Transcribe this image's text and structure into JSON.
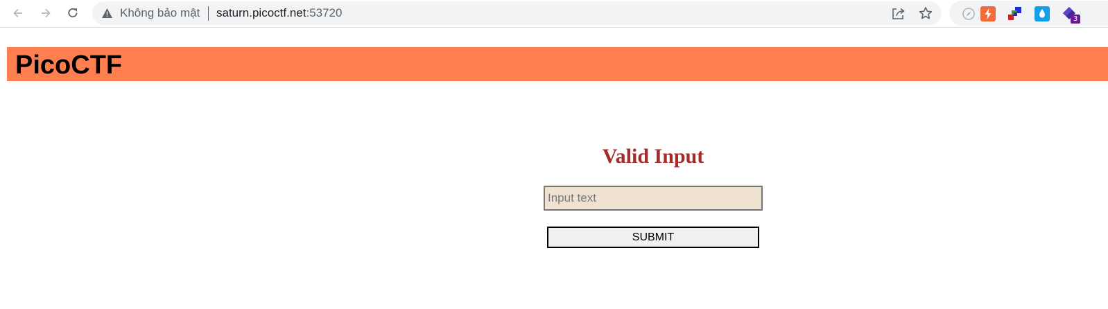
{
  "browser": {
    "security_label": "Không bảo mật",
    "url_host": "saturn.picoctf.net",
    "url_port": ":53720",
    "extension_badge_count": "3",
    "icons": [
      "back-arrow-icon",
      "forward-arrow-icon",
      "reload-icon",
      "warning-icon",
      "share-icon",
      "star-icon",
      "compass-icon",
      "bolt-icon",
      "squares-icon",
      "drop-icon",
      "diamond-icon"
    ]
  },
  "page": {
    "site_title": "PicoCTF",
    "header_color": "#ff7f50",
    "form": {
      "heading": "Valid Input",
      "heading_color": "#a52a2a",
      "input_value": "",
      "input_placeholder": "Input text",
      "input_background": "#f0e2d0",
      "submit_label": "SUBMIT"
    }
  }
}
